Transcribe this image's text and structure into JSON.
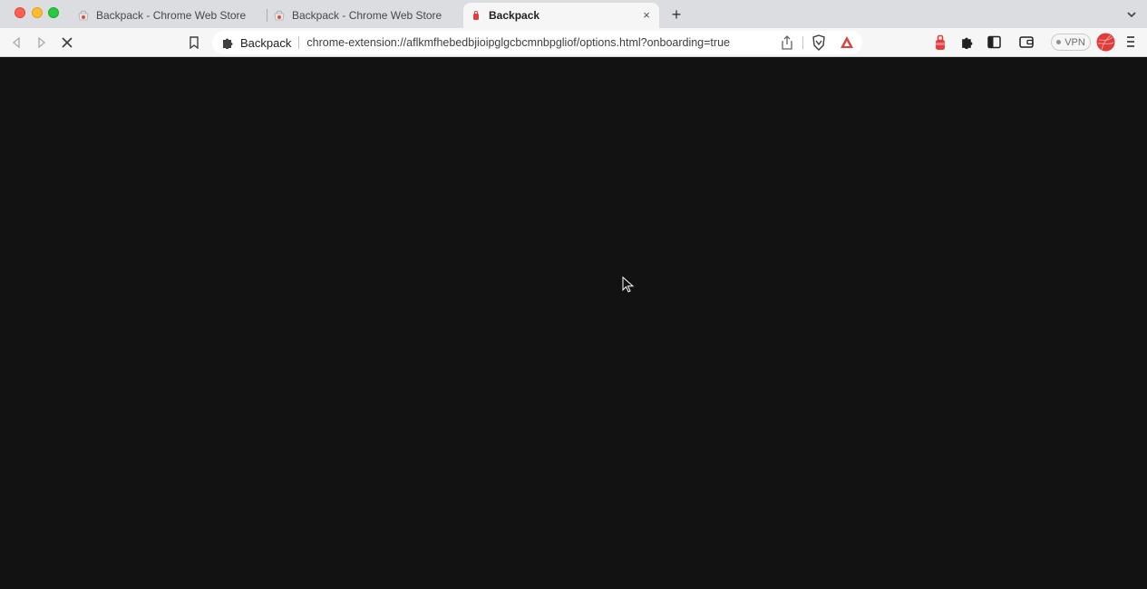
{
  "tabs": [
    {
      "title": "Backpack - Chrome Web Store",
      "favicon": "chrome-web-store-icon",
      "active": false
    },
    {
      "title": "Backpack - Chrome Web Store",
      "favicon": "chrome-web-store-icon",
      "active": false
    },
    {
      "title": "Backpack",
      "favicon": "backpack-icon",
      "active": true
    }
  ],
  "newtab_label": "+",
  "close_label": "×",
  "omnibox": {
    "site_label": "Backpack",
    "url": "chrome-extension://aflkmfhebedbjioipglgcbcmnbpgliof/options.html?onboarding=true"
  },
  "vpn_label": "VPN",
  "colors": {
    "page_background": "#121212",
    "brave_red": "#e2413b",
    "backpack_red": "#e33e3f"
  }
}
